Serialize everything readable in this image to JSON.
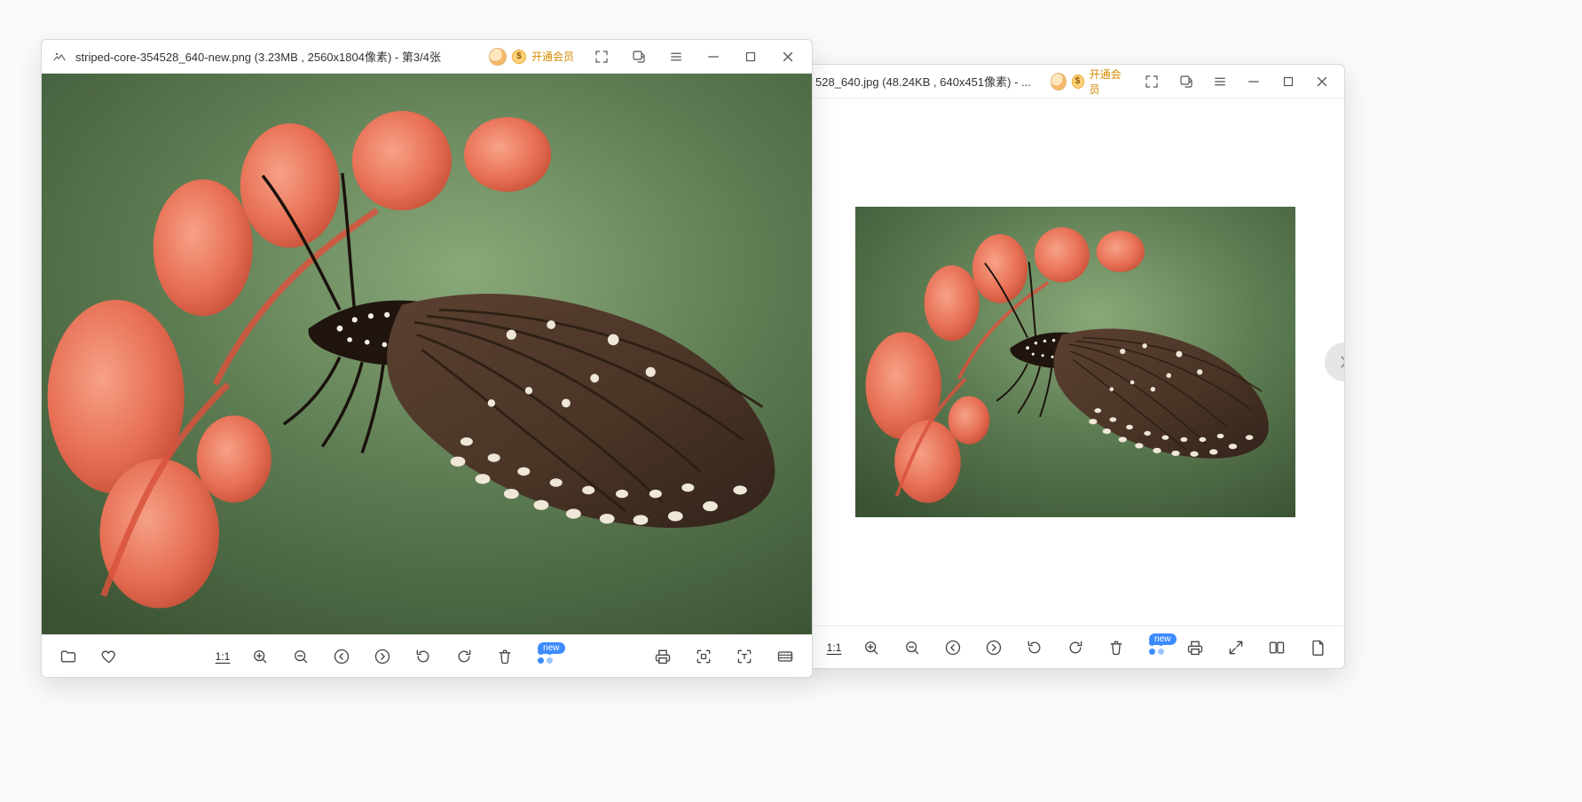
{
  "windows": [
    {
      "id": "w2",
      "title_filename": "528_640.jpg",
      "title_size": "48.24KB",
      "title_dims": "640x451像素",
      "title_counter": "...",
      "vip_label": "开通会员",
      "ratio_label": "1:1",
      "new_badge": "new"
    },
    {
      "id": "w1",
      "title_filename": "striped-core-354528_640-new.png",
      "title_size": "3.23MB",
      "title_dims": "2560x1804像素",
      "title_counter": "第3/4张",
      "vip_label": "开通会员",
      "ratio_label": "1:1",
      "new_badge": "new"
    }
  ],
  "icons": {
    "fullscreen": "fullscreen-icon",
    "rotate_window": "rotate-window-icon",
    "menu": "menu-icon",
    "minimize": "minimize-icon",
    "maximize": "maximize-icon",
    "close": "close-icon"
  }
}
